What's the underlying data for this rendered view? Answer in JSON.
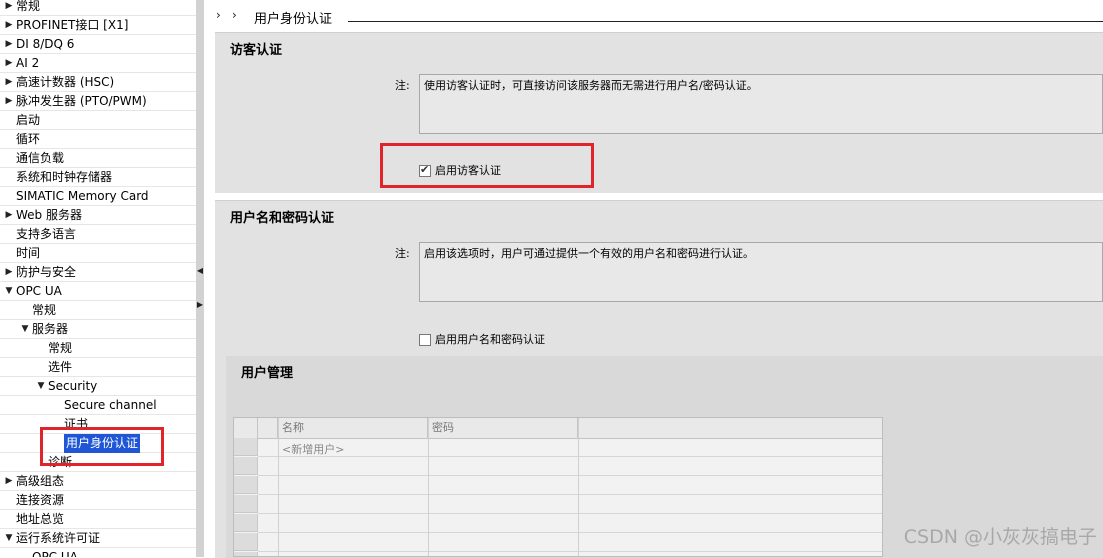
{
  "nav": {
    "items": [
      {
        "label": "常规",
        "arrow": "▶"
      },
      {
        "label": "PROFINET接口 [X1]",
        "arrow": "▶"
      },
      {
        "label": "DI 8/DQ 6",
        "arrow": "▶"
      },
      {
        "label": "AI 2",
        "arrow": "▶"
      },
      {
        "label": "高速计数器 (HSC)",
        "arrow": "▶"
      },
      {
        "label": "脉冲发生器 (PTO/PWM)",
        "arrow": "▶"
      },
      {
        "label": "启动",
        "arrow": ""
      },
      {
        "label": "循环",
        "arrow": ""
      },
      {
        "label": "通信负载",
        "arrow": ""
      },
      {
        "label": "系统和时钟存储器",
        "arrow": ""
      },
      {
        "label": "SIMATIC Memory Card",
        "arrow": ""
      },
      {
        "label": "Web 服务器",
        "arrow": "▶"
      },
      {
        "label": "支持多语言",
        "arrow": ""
      },
      {
        "label": "时间",
        "arrow": ""
      },
      {
        "label": "防护与安全",
        "arrow": "▶"
      },
      {
        "label": "OPC UA",
        "arrow": "▼"
      },
      {
        "label": "常规",
        "arrow": ""
      },
      {
        "label": "服务器",
        "arrow": "▼"
      },
      {
        "label": "常规",
        "arrow": ""
      },
      {
        "label": "选件",
        "arrow": ""
      },
      {
        "label": "Security",
        "arrow": "▼"
      },
      {
        "label": "Secure channel",
        "arrow": ""
      },
      {
        "label": "证书",
        "arrow": ""
      },
      {
        "label": "用户身份认证",
        "arrow": ""
      },
      {
        "label": "诊断",
        "arrow": ""
      },
      {
        "label": "高级组态",
        "arrow": "▶"
      },
      {
        "label": "连接资源",
        "arrow": ""
      },
      {
        "label": "地址总览",
        "arrow": ""
      },
      {
        "label": "运行系统许可证",
        "arrow": "▼"
      },
      {
        "label": "OPC UA",
        "arrow": ""
      }
    ]
  },
  "header": {
    "breadcrumb_chevrons": "›  ›",
    "title": "用户身份认证"
  },
  "guest_auth": {
    "title": "访客认证",
    "note_label": "注:",
    "note_text": "使用访客认证时，可直接访问该服务器而无需进行用户名/密码认证。",
    "checkbox_label": "启用访客认证",
    "checked": true
  },
  "userpass_auth": {
    "title": "用户名和密码认证",
    "note_label": "注:",
    "note_text": "启用该选项时，用户可通过提供一个有效的用户名和密码进行认证。",
    "checkbox_label": "启用用户名和密码认证",
    "checked": false
  },
  "user_mgmt": {
    "title": "用户管理",
    "columns": [
      "名称",
      "密码"
    ],
    "placeholder_row": "<新增用户>"
  },
  "watermark": "CSDN @小灰灰搞电子",
  "colors": {
    "highlight_box": "#e0242b",
    "selection": "#1e56d6"
  }
}
